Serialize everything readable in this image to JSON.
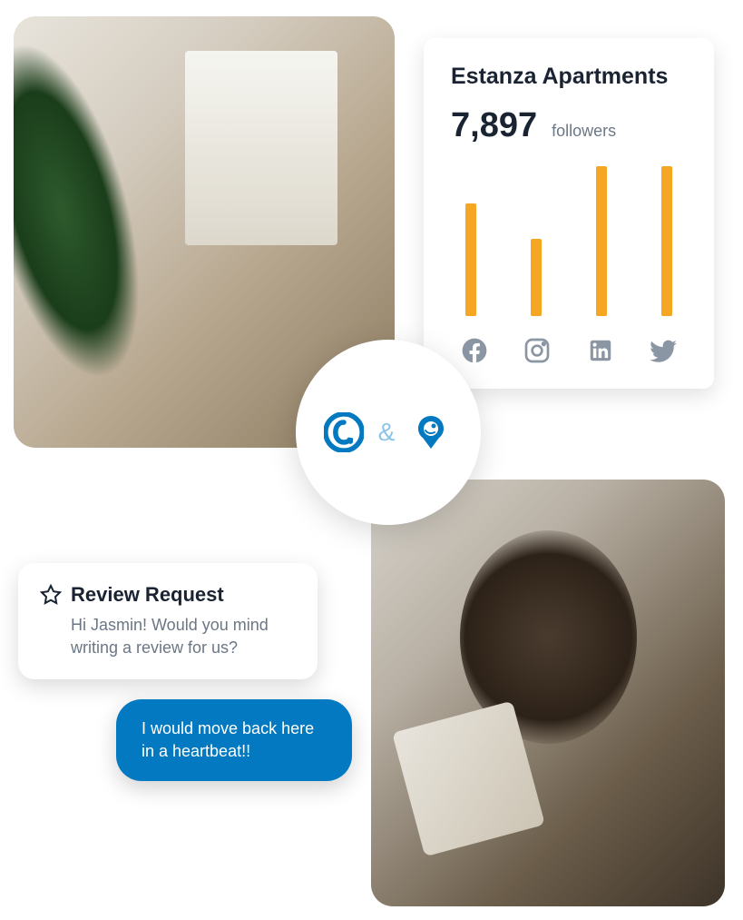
{
  "stats": {
    "title": "Estanza Apartments",
    "count": "7,897",
    "label": "followers"
  },
  "chart_data": {
    "type": "bar",
    "categories": [
      "facebook",
      "instagram",
      "linkedin",
      "twitter"
    ],
    "values": [
      125,
      85,
      165,
      165
    ],
    "ylim": [
      0,
      170
    ]
  },
  "badge": {
    "and": "&"
  },
  "review": {
    "title": "Review Request",
    "text": "Hi Jasmin! Would you mind writing a review for us?"
  },
  "reply": {
    "text": "I would move back here in a heartbeat!!"
  },
  "colors": {
    "accent": "#0279c0",
    "bars": "#f5a623"
  }
}
